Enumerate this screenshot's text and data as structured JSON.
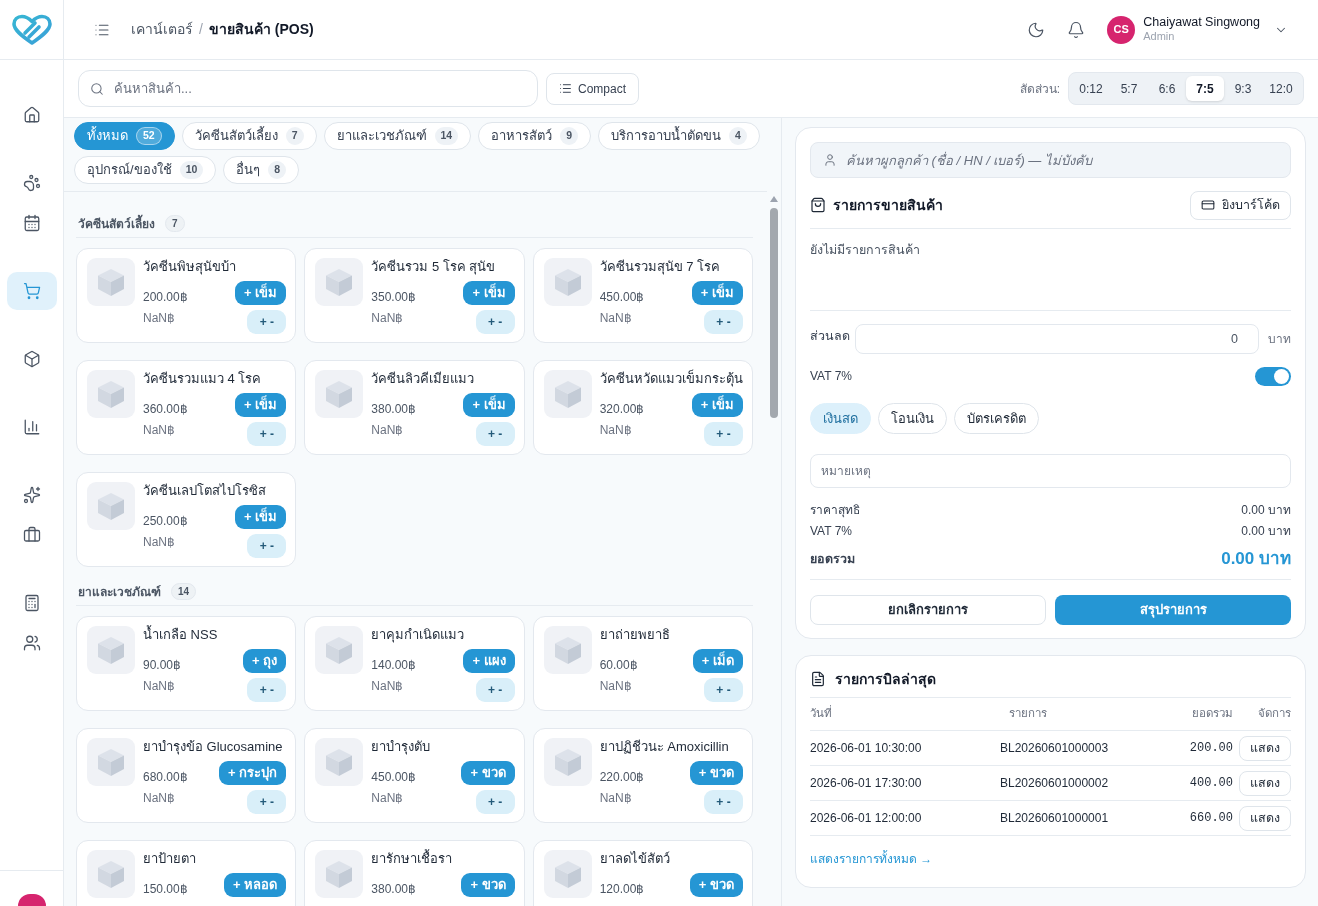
{
  "sidebar": {
    "groups": [
      {
        "items": [
          {
            "selected": false
          }
        ]
      },
      {
        "items": [
          {
            "selected": false
          },
          {
            "selected": false
          }
        ]
      },
      {
        "items": [
          {
            "selected": true
          }
        ]
      },
      {
        "items": [
          {
            "selected": false
          }
        ]
      },
      {
        "items": [
          {
            "selected": false
          }
        ]
      },
      {
        "items": [
          {
            "selected": false
          },
          {
            "selected": false
          }
        ]
      },
      {
        "items": [
          {
            "selected": false
          },
          {
            "selected": false
          }
        ]
      }
    ]
  },
  "header": {
    "breadcrumb": {
      "items": [
        "เคาน์เตอร์",
        "ขายสินค้า (POS)"
      ],
      "separator": "/"
    },
    "user": {
      "initials": "CS",
      "name": "Chaiyawat Singwong",
      "role": "Admin"
    }
  },
  "toolbar": {
    "search": {
      "placeholder": "ค้นหาสินค้า..."
    },
    "view_button": "Compact",
    "ratio": {
      "label": "สัดส่วน:",
      "options": [
        {
          "label": "0:12",
          "selected": false
        },
        {
          "label": "5:7",
          "selected": false
        },
        {
          "label": "6:6",
          "selected": false
        },
        {
          "label": "7:5",
          "selected": true
        },
        {
          "label": "9:3",
          "selected": false
        },
        {
          "label": "12:0",
          "selected": false
        }
      ]
    }
  },
  "categories": [
    {
      "label": "ทั้งหมด",
      "count": "52",
      "selected": true
    },
    {
      "label": "วัคซีนสัตว์เลี้ยง",
      "count": "7",
      "selected": false
    },
    {
      "label": "ยาและเวชภัณฑ์",
      "count": "14",
      "selected": false
    },
    {
      "label": "อาหารสัตว์",
      "count": "9",
      "selected": false
    },
    {
      "label": "บริการอาบน้ำตัดขน",
      "count": "4",
      "selected": false
    },
    {
      "label": "อุปกรณ์/ของใช้",
      "count": "10",
      "selected": false
    },
    {
      "label": "อื่นๆ",
      "count": "8",
      "selected": false
    }
  ],
  "sections": [
    {
      "title": "วัคซีนสัตว์เลี้ยง",
      "count": "7",
      "products": [
        {
          "name": "วัคซีนพิษสุนัขบ้า",
          "price": "200.00฿",
          "stock": "NaN฿",
          "unit_button": "+ เข็ม",
          "qty_button": "+ -"
        },
        {
          "name": "วัคซีนรวม 5 โรค สุนัข",
          "price": "350.00฿",
          "stock": "NaN฿",
          "unit_button": "+ เข็ม",
          "qty_button": "+ -"
        },
        {
          "name": "วัคซีนรวมสุนัข 7 โรค",
          "price": "450.00฿",
          "stock": "NaN฿",
          "unit_button": "+ เข็ม",
          "qty_button": "+ -"
        },
        {
          "name": "วัคซีนรวมแมว 4 โรค",
          "price": "360.00฿",
          "stock": "NaN฿",
          "unit_button": "+ เข็ม",
          "qty_button": "+ -"
        },
        {
          "name": "วัคซีนลิวคีเมียแมว",
          "price": "380.00฿",
          "stock": "NaN฿",
          "unit_button": "+ เข็ม",
          "qty_button": "+ -"
        },
        {
          "name": "วัคซีนหวัดแมวเข็มกระตุ้น",
          "price": "320.00฿",
          "stock": "NaN฿",
          "unit_button": "+ เข็ม",
          "qty_button": "+ -"
        },
        {
          "name": "วัคซีนเลปโตสไปโรซิส",
          "price": "250.00฿",
          "stock": "NaN฿",
          "unit_button": "+ เข็ม",
          "qty_button": "+ -"
        }
      ]
    },
    {
      "title": "ยาและเวชภัณฑ์",
      "count": "14",
      "products": [
        {
          "name": "น้ำเกลือ NSS",
          "price": "90.00฿",
          "stock": "NaN฿",
          "unit_button": "+ ถุง",
          "qty_button": "+ -"
        },
        {
          "name": "ยาคุมกำเนิดแมว",
          "price": "140.00฿",
          "stock": "NaN฿",
          "unit_button": "+ แผง",
          "qty_button": "+ -"
        },
        {
          "name": "ยาถ่ายพยาธิ",
          "price": "60.00฿",
          "stock": "NaN฿",
          "unit_button": "+ เม็ด",
          "qty_button": "+ -"
        },
        {
          "name": "ยาบำรุงข้อ Glucosamine",
          "price": "680.00฿",
          "stock": "NaN฿",
          "unit_button": "+ กระปุก",
          "qty_button": "+ -"
        },
        {
          "name": "ยาบำรุงตับ",
          "price": "450.00฿",
          "stock": "NaN฿",
          "unit_button": "+ ขวด",
          "qty_button": "+ -"
        },
        {
          "name": "ยาปฏิชีวนะ Amoxicillin",
          "price": "220.00฿",
          "stock": "NaN฿",
          "unit_button": "+ ขวด",
          "qty_button": "+ -"
        },
        {
          "name": "ยาป้ายตา",
          "price": "150.00฿",
          "unit_button": "+ หลอด"
        },
        {
          "name": "ยารักษาเชื้อรา",
          "price": "380.00฿",
          "unit_button": "+ ขวด"
        },
        {
          "name": "ยาลดไข้สัตว์",
          "price": "120.00฿",
          "unit_button": "+ ขวด"
        }
      ]
    }
  ],
  "cart": {
    "customer_search": {
      "placeholder": "ค้นหาผูกลูกค้า (ชื่อ / HN / เบอร์) — ไม่บังคับ"
    },
    "title": "รายการขายสินค้า",
    "barcode_button": "ยิงบาร์โค้ด",
    "empty_text": "ยังไม่มีรายการสินค้า",
    "discount": {
      "label": "ส่วนลด",
      "value": "0",
      "unit": "บาท"
    },
    "vat": {
      "label": "VAT 7%",
      "on": true
    },
    "payment_methods": [
      {
        "label": "เงินสด",
        "selected": true
      },
      {
        "label": "โอนเงิน",
        "selected": false
      },
      {
        "label": "บัตรเครดิต",
        "selected": false
      }
    ],
    "note": {
      "placeholder": "หมายเหตุ"
    },
    "summary": [
      {
        "label": "ราคาสุทธิ",
        "value": "0.00 บาท"
      },
      {
        "label": "VAT 7%",
        "value": "0.00 บาท"
      }
    ],
    "total": {
      "label": "ยอดรวม",
      "value": "0.00 บาท"
    },
    "buttons": [
      {
        "label": "ยกเลิกรายการ",
        "kind": "secondary"
      },
      {
        "label": "สรุปรายการ",
        "kind": "primary"
      }
    ]
  },
  "recent_bills": {
    "title": "รายการบิลล่าสุด",
    "columns": [
      "วันที่",
      "รายการ",
      "ยอดรวม",
      "จัดการ"
    ],
    "rows": [
      {
        "date": "2026-06-01 10:30:00",
        "bill_no": "BL20260601000003",
        "total": "200.00",
        "action": "แสดง"
      },
      {
        "date": "2026-06-01 17:30:00",
        "bill_no": "BL20260601000002",
        "total": "400.00",
        "action": "แสดง"
      },
      {
        "date": "2026-06-01 12:00:00",
        "bill_no": "BL20260601000001",
        "total": "660.00",
        "action": "แสดง"
      }
    ],
    "view_all_link": "แสดงรายการทั้งหมด →"
  }
}
